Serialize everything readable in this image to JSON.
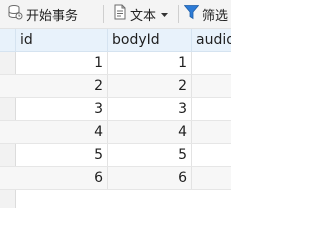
{
  "toolbar": {
    "begin_transaction_label": "开始事务",
    "text_label": "文本",
    "filter_label": "筛选"
  },
  "table": {
    "columns": [
      "id",
      "bodyId",
      "audio"
    ],
    "rows": [
      {
        "id": "1",
        "bodyId": "1"
      },
      {
        "id": "2",
        "bodyId": "2"
      },
      {
        "id": "3",
        "bodyId": "3"
      },
      {
        "id": "4",
        "bodyId": "4"
      },
      {
        "id": "5",
        "bodyId": "5"
      },
      {
        "id": "6",
        "bodyId": "6"
      }
    ]
  },
  "colors": {
    "header_bg": "#e8f2fb",
    "filter_icon": "#2d7bd6",
    "toolbar_bg": "#f4f4f4"
  },
  "icons": [
    "database-transaction-icon",
    "document-text-icon",
    "caret-down-icon",
    "filter-funnel-icon"
  ]
}
